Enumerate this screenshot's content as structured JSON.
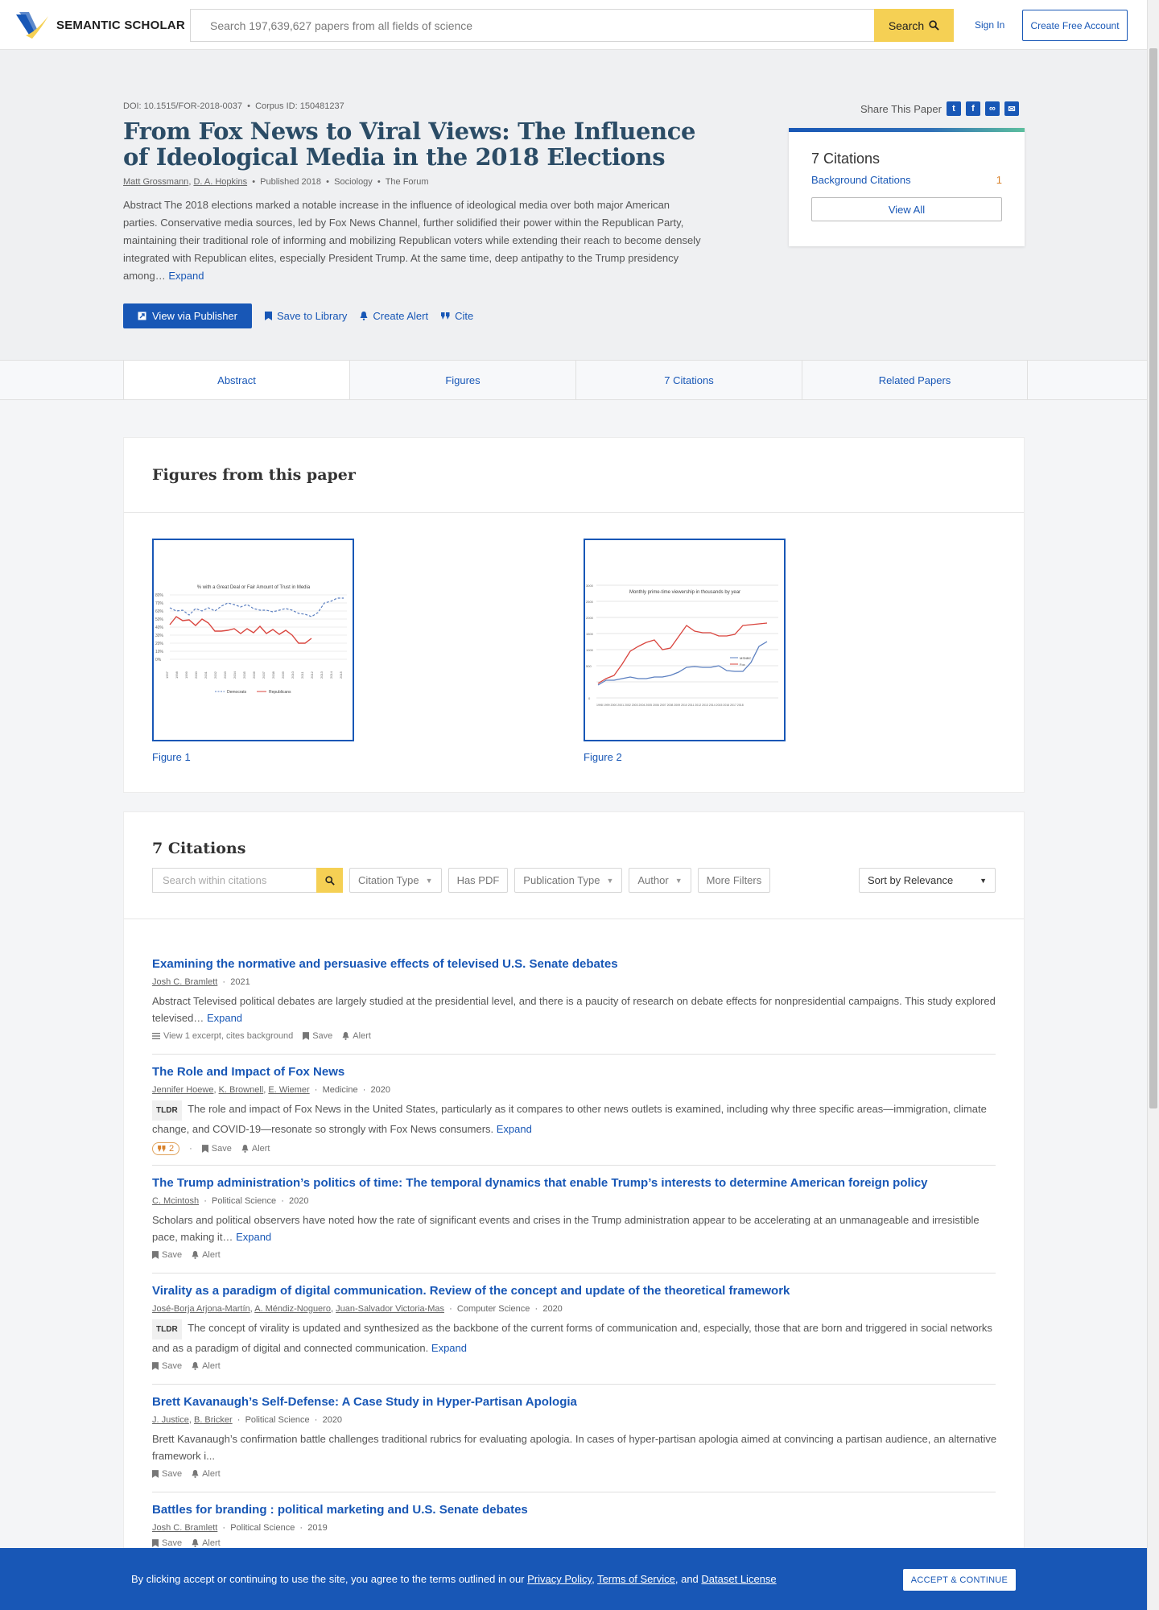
{
  "header": {
    "logo_text_bold": "SEMANTIC",
    "logo_text_light": "SCHOLAR",
    "search_placeholder": "Search 197,639,627 papers from all fields of science",
    "search_button": "Search",
    "sign_in": "Sign In",
    "create_account": "Create Free Account"
  },
  "paper": {
    "doi": "DOI: 10.1515/FOR-2018-0037",
    "corpus_id": "Corpus ID: 150481237",
    "title": "From Fox News to Viral Views: The Influence of Ideological Media in the 2018 Elections",
    "authors": [
      "Matt Grossmann",
      "D. A. Hopkins"
    ],
    "published": "Published 2018",
    "field": "Sociology",
    "venue": "The Forum",
    "abstract": "Abstract The 2018 elections marked a notable increase in the influence of ideological media over both major American parties. Conservative media sources, led by Fox News Channel, further solidified their power within the Republican Party, maintaining their traditional role of informing and mobilizing Republican voters while extending their reach to become densely integrated with Republican elites, especially President Trump. At the same time, deep antipathy to the Trump presidency among…",
    "expand": "Expand",
    "actions": {
      "view_publisher": "View via Publisher",
      "save": "Save to Library",
      "alert": "Create Alert",
      "cite": "Cite"
    },
    "share_label": "Share This Paper"
  },
  "citation_card": {
    "count": "7 Citations",
    "background_label": "Background Citations",
    "background_count": "1",
    "view_all": "View All"
  },
  "tabs": [
    "Abstract",
    "Figures",
    "7 Citations",
    "Related Papers"
  ],
  "figures": {
    "heading": "Figures from this paper",
    "items": [
      {
        "label": "Figure 1",
        "caption": "% with a Great Deal or Fair Amount of Trust in Media",
        "legend": [
          "Democrats",
          "Republicans"
        ]
      },
      {
        "label": "Figure 2",
        "caption": "Monthly prime-time viewership in thousands by year",
        "legend": [
          "MSNBC",
          "Fox"
        ]
      }
    ]
  },
  "citations": {
    "heading": "7 Citations",
    "search_placeholder": "Search within citations",
    "filters": [
      "Citation Type",
      "Has PDF",
      "Publication Type",
      "Author",
      "More Filters"
    ],
    "sort": "Sort by Relevance",
    "items": [
      {
        "title": "Examining the normative and persuasive effects of televised U.S. Senate debates",
        "authors": [
          "Josh C. Bramlett"
        ],
        "meta": [
          "2021"
        ],
        "tldr": false,
        "abstract": "Abstract Televised political debates are largely studied at the presidential level, and there is a paucity of research on debate effects for nonpresidential campaigns. This study explored televised…",
        "expand": "Expand",
        "extra": "View 1 excerpt, cites background",
        "cites": ""
      },
      {
        "title": "The Role and Impact of Fox News",
        "authors": [
          "Jennifer Hoewe",
          "K. Brownell",
          "E. Wiemer"
        ],
        "meta": [
          "Medicine",
          "2020"
        ],
        "tldr": true,
        "abstract": "The role and impact of Fox News in the United States, particularly as it compares to other news outlets is examined, including why three specific areas—immigration, climate change, and COVID-19—resonate so strongly with Fox News consumers.",
        "expand": "Expand",
        "extra": "",
        "cites": "2"
      },
      {
        "title": "The Trump administration’s politics of time: The temporal dynamics that enable Trump’s interests to determine American foreign policy",
        "authors": [
          "C. Mcintosh"
        ],
        "meta": [
          "Political Science",
          "2020"
        ],
        "tldr": false,
        "abstract": "Scholars and political observers have noted how the rate of significant events and crises in the Trump administration appear to be accelerating at an unmanageable and irresistible pace, making it…",
        "expand": "Expand",
        "extra": "",
        "cites": ""
      },
      {
        "title": "Virality as a paradigm of digital communication. Review of the concept and update of the theoretical framework",
        "authors": [
          "José-Borja Arjona-Martín",
          "A. Méndiz-Noguero",
          "Juan-Salvador Victoria-Mas"
        ],
        "meta": [
          "Computer Science",
          "2020"
        ],
        "tldr": true,
        "abstract": "The concept of virality is updated and synthesized as the backbone of the current forms of communication and, especially, those that are born and triggered in social networks and as a paradigm of digital and connected communication.",
        "expand": "Expand",
        "extra": "",
        "cites": ""
      },
      {
        "title": "Brett Kavanaugh’s Self-Defense: A Case Study in Hyper-Partisan Apologia",
        "authors": [
          "J. Justice",
          "B. Bricker"
        ],
        "meta": [
          "Political Science",
          "2020"
        ],
        "tldr": false,
        "abstract": "Brett Kavanaugh’s confirmation battle challenges traditional rubrics for evaluating apologia. In cases of hyper-partisan apologia aimed at convincing a partisan audience, an alternative framework i...",
        "expand": "",
        "extra": "",
        "cites": ""
      },
      {
        "title": "Battles for branding : political marketing and U.S. Senate debates",
        "authors": [
          "Josh C. Bramlett"
        ],
        "meta": [
          "Political Science",
          "2019"
        ],
        "tldr": false,
        "abstract": "",
        "expand": "",
        "extra": "",
        "cites": ""
      }
    ],
    "save_label": "Save",
    "alert_label": "Alert",
    "tldr_label": "TLDR"
  },
  "cookie": {
    "text_start": "By clicking accept or continuing to use the site, you agree to the terms outlined in our ",
    "privacy": "Privacy Policy",
    "sep1": ", ",
    "terms": "Terms of Service",
    "sep2": ", and ",
    "license": "Dataset License",
    "button": "ACCEPT & CONTINUE"
  },
  "colors": {
    "brand_blue": "#1857b6",
    "search_yellow": "#f5d054",
    "title_navy": "#2b4c66",
    "hero_bg": "#eff0f2"
  }
}
